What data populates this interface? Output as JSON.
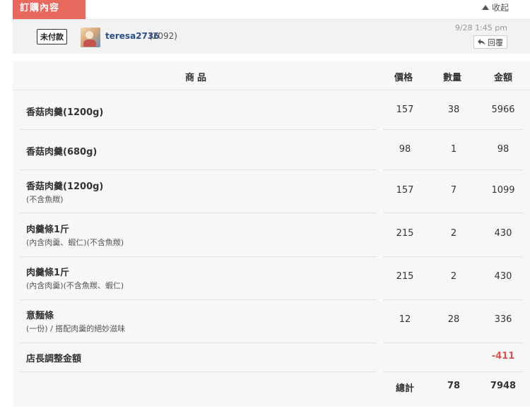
{
  "tab_title": "訂購內容",
  "collapse_label": "收起",
  "buyer": {
    "status": "未付款",
    "username": "teresa2736",
    "score": "(2092)",
    "timestamp": "9/28  1:45 pm",
    "reply_label": "回覆"
  },
  "table": {
    "headers": {
      "product": "商品",
      "price": "價格",
      "qty": "數量",
      "amount": "金額"
    },
    "rows": [
      {
        "name": "香菇肉羹(1200g)",
        "note": "",
        "price": "157",
        "qty": "38",
        "amount": "5966"
      },
      {
        "name": "香菇肉羹(680g)",
        "note": "",
        "price": "98",
        "qty": "1",
        "amount": "98"
      },
      {
        "name": "香菇肉羹(1200g)",
        "note": "(不含魚羰)",
        "price": "157",
        "qty": "7",
        "amount": "1099"
      },
      {
        "name": "肉羹條1斤",
        "note": "(內含肉羹、蝦仁)(不含魚羰)",
        "price": "215",
        "qty": "2",
        "amount": "430"
      },
      {
        "name": "肉羹條1斤",
        "note": "(內含肉羹)(不含魚羰、蝦仁)",
        "price": "215",
        "qty": "2",
        "amount": "430"
      },
      {
        "name": "意麵條",
        "note": "(一份) / 搭配肉羹的絕妙滋味",
        "price": "12",
        "qty": "28",
        "amount": "336"
      }
    ],
    "adjust_label": "店長調整金額",
    "adjust_amount": "-411",
    "total_label": "總計",
    "total_qty": "78",
    "total_amount": "7948"
  }
}
